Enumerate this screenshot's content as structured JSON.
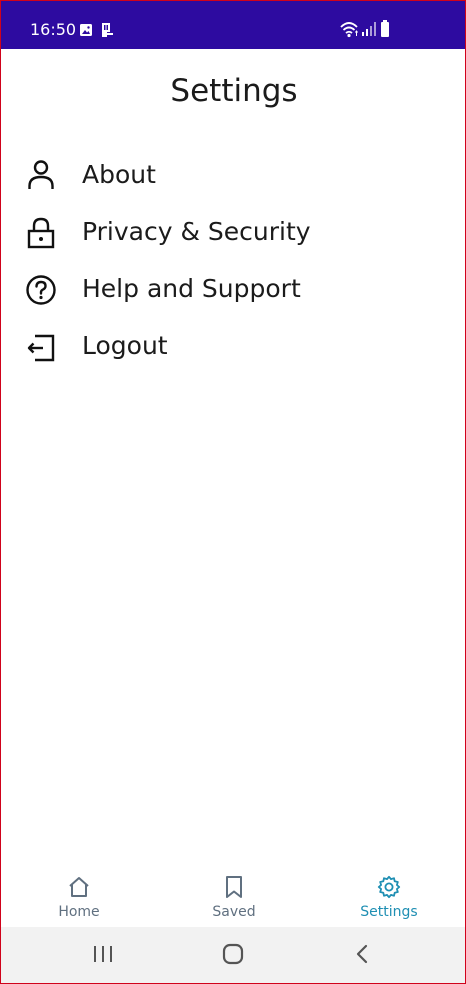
{
  "status_bar": {
    "time": "16:50",
    "icons": [
      "image-icon",
      "sim-card-icon",
      "wifi-icon",
      "signal-icon",
      "battery-icon"
    ],
    "background": "#2d0ba0"
  },
  "header": {
    "title": "Settings"
  },
  "menu": {
    "items": [
      {
        "label": "About",
        "icon": "person-icon"
      },
      {
        "label": "Privacy & Security",
        "icon": "lock-icon"
      },
      {
        "label": "Help and Support",
        "icon": "help-circle-icon"
      },
      {
        "label": "Logout",
        "icon": "logout-icon"
      }
    ]
  },
  "bottom_nav": {
    "items": [
      {
        "label": "Home",
        "icon": "home-icon",
        "active": false
      },
      {
        "label": "Saved",
        "icon": "bookmark-icon",
        "active": false
      },
      {
        "label": "Settings",
        "icon": "gear-icon",
        "active": true
      }
    ],
    "active_color": "#1f8fb3",
    "inactive_color": "#607080"
  },
  "system_nav": {
    "buttons": [
      "recent-apps-icon",
      "home-circle-icon",
      "back-icon"
    ]
  }
}
